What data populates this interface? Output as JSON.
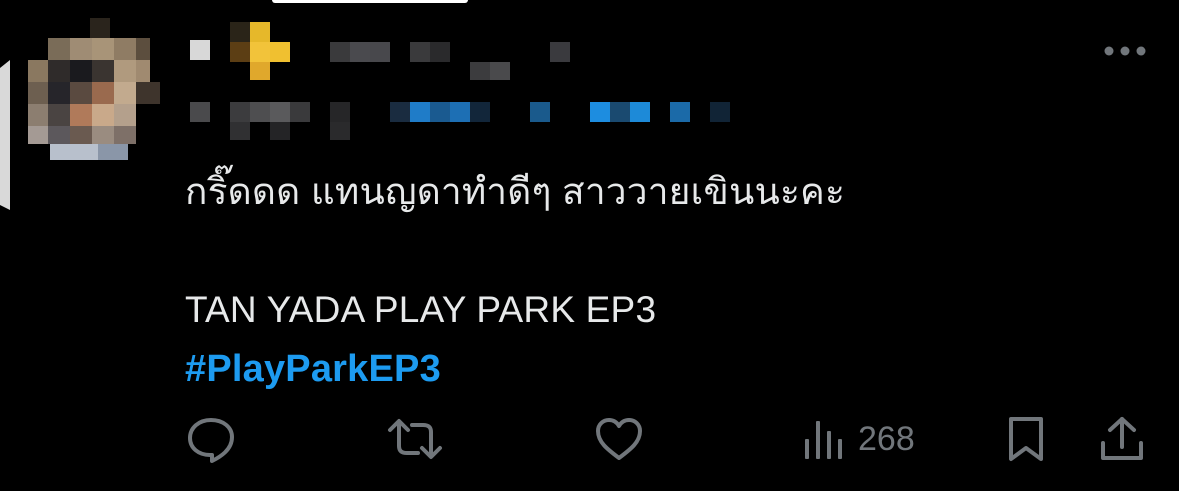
{
  "tweet": {
    "text_line1": "กริ๊ดดด แทนญดาทำดีๆ สาววายเขินนะคะ",
    "text_line2": "TAN YADA PLAY PARK EP3",
    "hashtag": "#PlayParkEP3"
  },
  "actions": {
    "reply": {
      "icon": "reply-icon"
    },
    "retweet": {
      "icon": "retweet-icon"
    },
    "like": {
      "icon": "heart-icon"
    },
    "views": {
      "icon": "views-icon",
      "count": "268"
    },
    "bookmark": {
      "icon": "bookmark-icon"
    },
    "share": {
      "icon": "share-icon"
    }
  },
  "more_menu": {
    "icon": "more-dots-icon"
  },
  "colors": {
    "background": "#000000",
    "text": "#e7e9ea",
    "secondary": "#71767b",
    "link": "#1d9bf0"
  }
}
